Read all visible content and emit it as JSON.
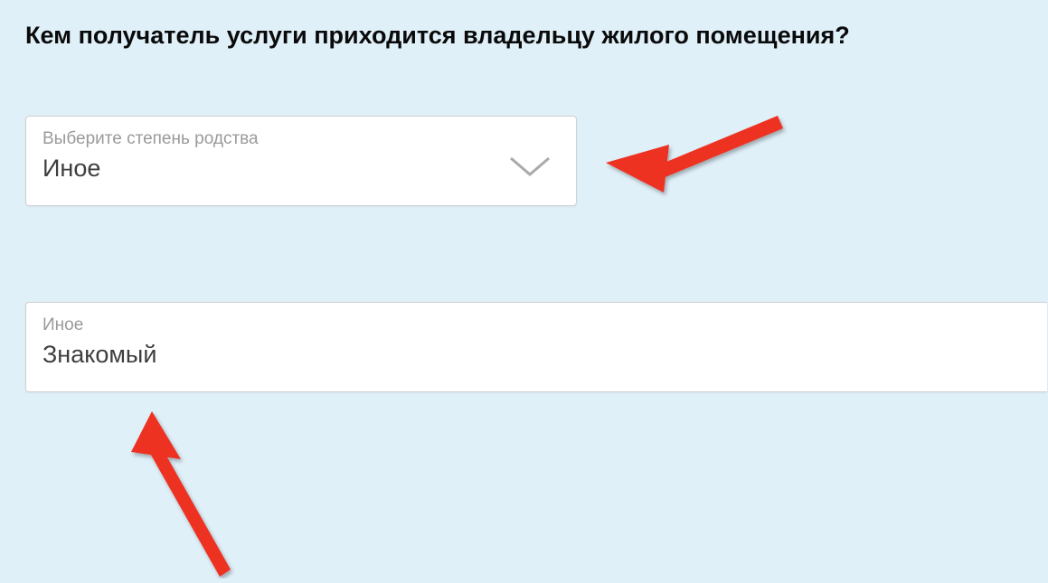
{
  "heading": "Кем получатель услуги приходится владельцу жилого помещения?",
  "select": {
    "label": "Выберите степень родства",
    "value": "Иное"
  },
  "input": {
    "label": "Иное",
    "value": "Знакомый"
  },
  "colors": {
    "background": "#e0f0f9",
    "arrow": "#ed3223",
    "textDark": "#0a0a0a",
    "textLabel": "#9a9a9a",
    "textValue": "#3e3e3e",
    "border": "#d0d0d0"
  }
}
